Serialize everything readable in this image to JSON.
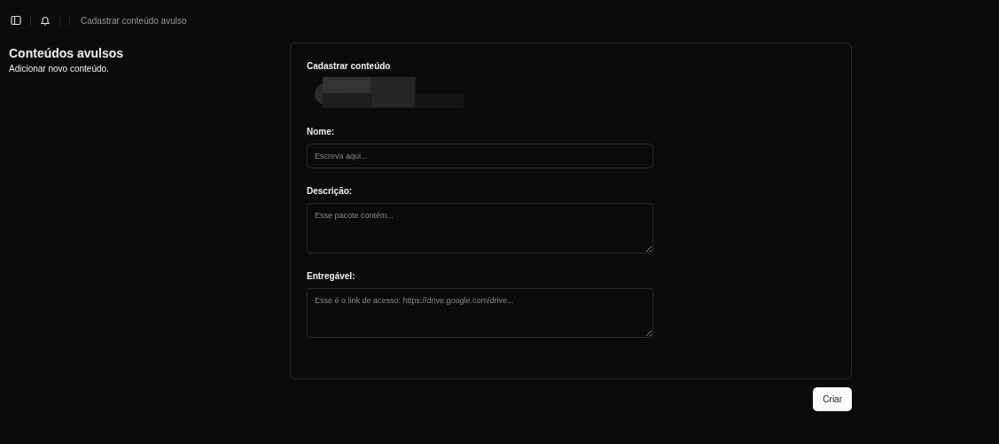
{
  "header": {
    "breadcrumb": "Cadastrar conteúdo avulso"
  },
  "sidebar": {
    "title": "Conteúdos avulsos",
    "subtitle": "Adicionar novo conteúdo."
  },
  "form": {
    "title": "Cadastrar conteúdo",
    "fields": [
      {
        "kind": "input",
        "label": "Nome:",
        "placeholder": "Escreva aqui..."
      },
      {
        "kind": "textarea",
        "label": "Descrição:",
        "placeholder": "Esse pacote contém..."
      },
      {
        "kind": "textarea",
        "label": "Entregável:",
        "placeholder": "Esse é o link de acesso: https://drive.google.com/drive..."
      }
    ]
  },
  "buttons": [
    {
      "label": "Criar"
    }
  ]
}
